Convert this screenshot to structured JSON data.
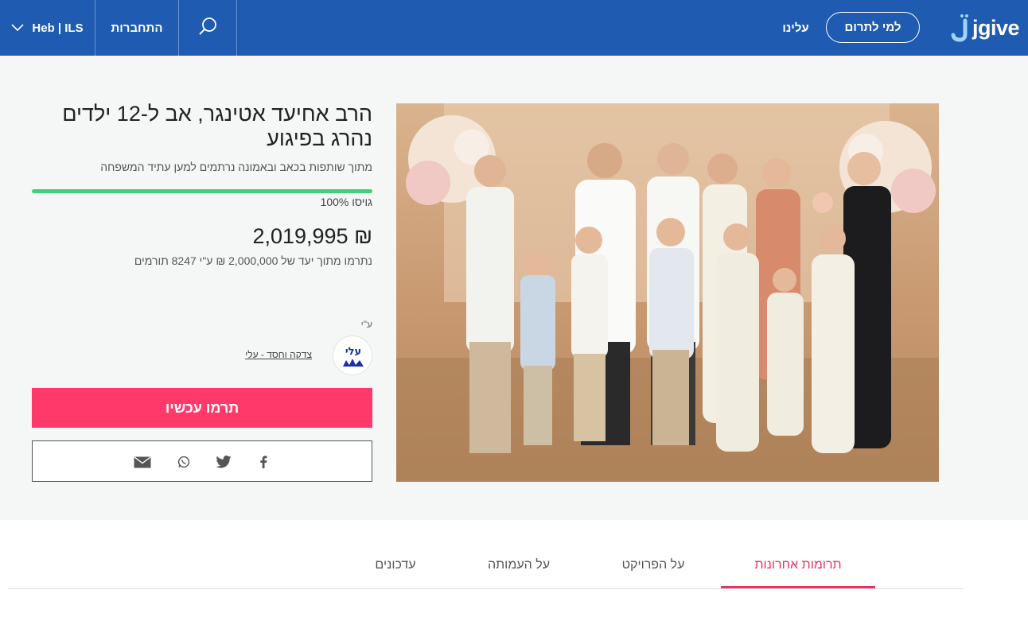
{
  "header": {
    "logo_text": "jgive",
    "donate_button": "למי לתרום",
    "about_link": "עלינו",
    "login_link": "התחברות",
    "lang_currency": "Heb | ILS",
    "search_icon": "search-icon",
    "chevron_icon": "chevron-down-icon",
    "colors": {
      "bar": "#1f5bb0"
    }
  },
  "campaign": {
    "title": "הרב אחיעד אטינגר, אב ל-12 ילדים נהרג בפיגוע",
    "subtitle": "מתוך שותפות בכאב ובאמונה נרתמים למען עתיד המשפחה",
    "progress_percent": 100,
    "funded_label": "גויסו 100%",
    "raised_amount": "₪ 2,019,995",
    "goal_text": "נתרמו מתוך יעד של 2,000,000 ₪ ע\"י 8247 תורמים",
    "by_label": "ע\"י",
    "org_name": "צדקה וחסד - עלי",
    "org_logo_text": "עלי",
    "cta_label": "תרמו עכשיו",
    "share_icons": [
      "facebook-icon",
      "twitter-icon",
      "whatsapp-icon",
      "email-icon"
    ],
    "colors": {
      "cta": "#ff3a6a",
      "progress": "#3fd07a"
    }
  },
  "tabs": [
    {
      "label": "תרומות אחרונות",
      "active": true
    },
    {
      "label": "על הפרויקט",
      "active": false
    },
    {
      "label": "על העמותה",
      "active": false
    },
    {
      "label": "עדכונים",
      "active": false
    }
  ]
}
